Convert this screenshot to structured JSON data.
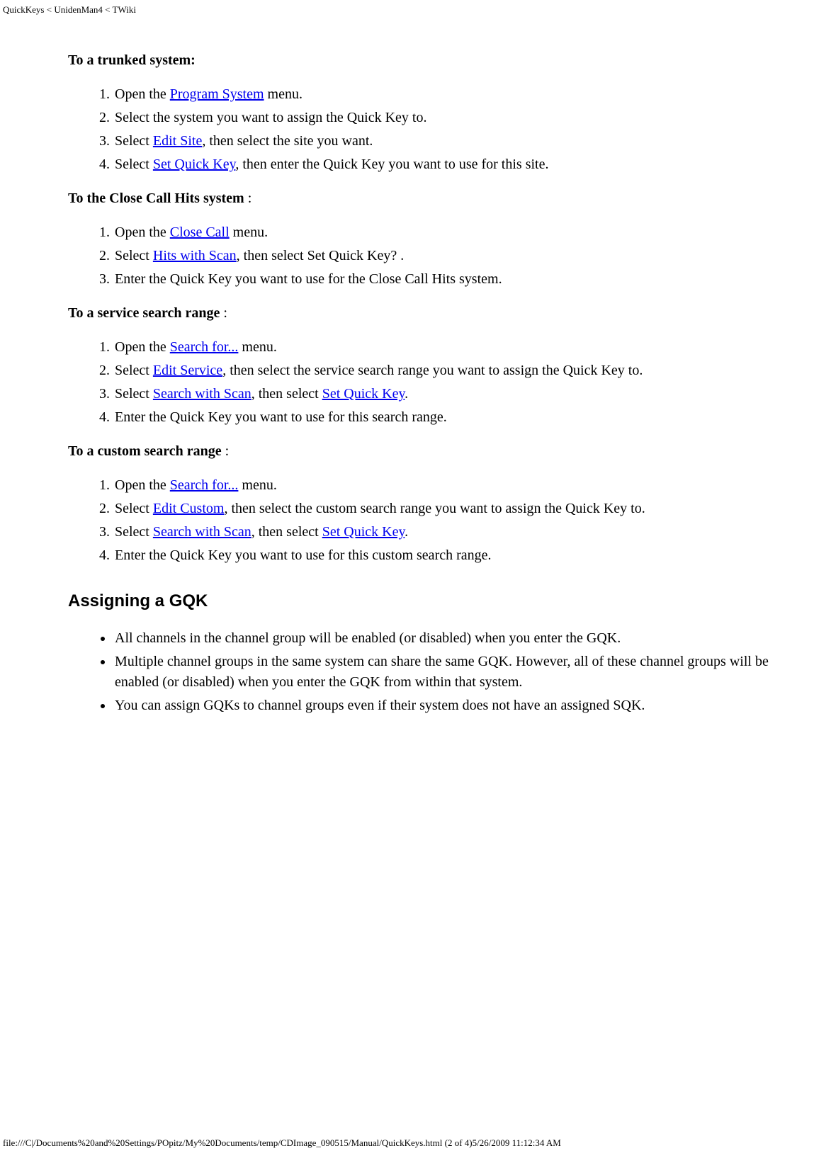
{
  "header_path": "QuickKeys < UnidenMan4 < TWiki",
  "footer_path": "file:///C|/Documents%20and%20Settings/POpitz/My%20Documents/temp/CDImage_090515/Manual/QuickKeys.html (2 of 4)5/26/2009 11:12:34 AM",
  "sections": {
    "trunked": {
      "title": "To a trunked system:",
      "items": [
        {
          "pre": "Open the ",
          "link": "Program System",
          "post": " menu."
        },
        {
          "pre": "Select the system you want to assign the Quick Key to."
        },
        {
          "pre": "Select ",
          "link": "Edit Site",
          "post": ", then select the site you want."
        },
        {
          "pre": "Select ",
          "link": "Set Quick Key",
          "post": ", then enter the Quick Key you want to use for this site."
        }
      ]
    },
    "closecall": {
      "title_bold": "To the Close Call Hits system",
      "title_tail": " :",
      "items": [
        {
          "pre": "Open the ",
          "link": "Close Call",
          "post": " menu."
        },
        {
          "pre": "Select ",
          "link": "Hits with Scan",
          "post": ", then select Set Quick Key? ."
        },
        {
          "pre": "Enter the Quick Key you want to use for the Close Call Hits system."
        }
      ]
    },
    "service": {
      "title_bold": "To a service search range",
      "title_tail": " :",
      "items": [
        {
          "pre": "Open the ",
          "link": "Search for...",
          "post": " menu."
        },
        {
          "pre": "Select ",
          "link": "Edit Service",
          "post": ", then select the service search range you want to assign the Quick Key to."
        },
        {
          "pre": "Select ",
          "link": "Search with Scan",
          "mid": ", then select ",
          "link2": "Set Quick Key",
          "post": "."
        },
        {
          "pre": "Enter the Quick Key you want to use for this search range."
        }
      ]
    },
    "custom": {
      "title_bold": "To a custom search range",
      "title_tail": " :",
      "items": [
        {
          "pre": "Open the ",
          "link": "Search for...",
          "post": " menu."
        },
        {
          "pre": "Select ",
          "link": "Edit Custom",
          "post": ", then select the custom search range you want to assign the Quick Key to."
        },
        {
          "pre": "Select ",
          "link": "Search with Scan",
          "mid": ", then select ",
          "link2": "Set Quick Key",
          "post": "."
        },
        {
          "pre": "Enter the Quick Key you want to use for this custom search range."
        }
      ]
    },
    "gqk": {
      "heading": "Assigning a GQK",
      "bullets": [
        "All channels in the channel group will be enabled (or disabled) when you enter the GQK.",
        "Multiple channel groups in the same system can share the same GQK. However, all of these channel groups will be enabled (or disabled) when you enter the GQK from within that system.",
        "You can assign GQKs to channel groups even if their system does not have an assigned SQK."
      ]
    }
  }
}
